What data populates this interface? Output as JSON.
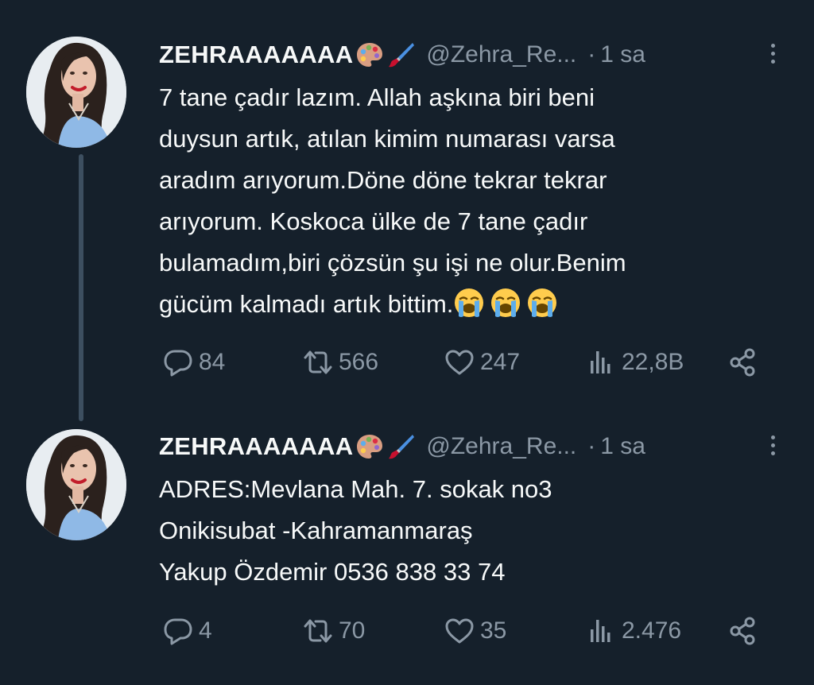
{
  "tweets": [
    {
      "display_name": "ZEHRAAAAAAA",
      "handle": "@Zehra_Re...",
      "separator": "·",
      "time": "1 sa",
      "lines": [
        "7 tane çadır lazım. Allah aşkına biri beni",
        "duysun artık, atılan kimim numarası varsa",
        "aradım arıyorum.Döne döne tekrar tekrar",
        "arıyorum. Koskoca ülke de 7 tane çadır",
        "bulamadım,biri çözsün şu işi ne olur.Benim",
        "gücüm kalmadı artık bittim."
      ],
      "trailing_emoji": "loudly-crying-face x3",
      "stats": {
        "replies": "84",
        "retweets": "566",
        "likes": "247",
        "views": "22,8B"
      }
    },
    {
      "display_name": "ZEHRAAAAAAA",
      "handle": "@Zehra_Re...",
      "separator": "·",
      "time": "1 sa",
      "lines": [
        "ADRES:Mevlana Mah. 7. sokak no3",
        "Onikisubat -Kahramanmaraş",
        "Yakup Özdemir 0536 838 33 74"
      ],
      "stats": {
        "replies": "4",
        "retweets": "70",
        "likes": "35",
        "views": "2.476"
      }
    }
  ],
  "icons": {
    "name_emojis": [
      "artist-palette-icon",
      "paintbrush-icon"
    ],
    "actions": [
      "reply-icon",
      "retweet-icon",
      "like-icon",
      "views-icon",
      "share-icon"
    ]
  },
  "colors": {
    "background": "#15202b",
    "text": "#f7f9f9",
    "muted": "#8b98a5",
    "thread_line": "#3d4f60"
  }
}
